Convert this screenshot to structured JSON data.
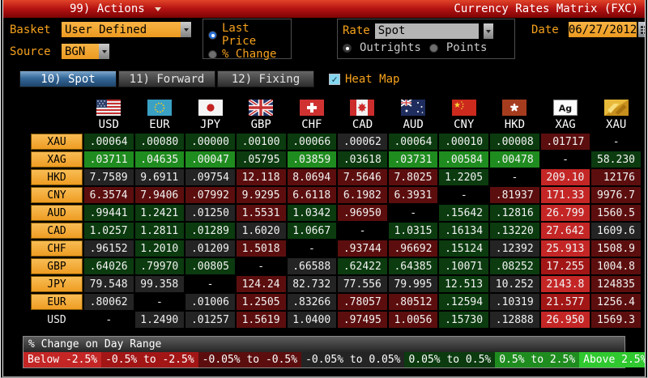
{
  "title_bar": {
    "actions_label": "99) Actions",
    "title": "Currency Rates Matrix (FXC)"
  },
  "controls": {
    "basket_label": "Basket",
    "basket_value": "User Defined",
    "source_label": "Source",
    "source_value": "BGN",
    "price_options": [
      {
        "label": "Last Price",
        "selected": true
      },
      {
        "label": "% Change",
        "selected": false
      }
    ],
    "rate_label": "Rate",
    "rate_value": "Spot",
    "rate_options": [
      {
        "label": "Outrights",
        "selected": true
      },
      {
        "label": "Points",
        "selected": false
      }
    ],
    "date_label": "Date",
    "date_value": "06/27/2012"
  },
  "tabs": [
    {
      "label": "10) Spot",
      "active": true
    },
    {
      "label": "11) Forward",
      "active": false
    },
    {
      "label": "12) Fixing",
      "active": false
    }
  ],
  "heat_map": {
    "label": "Heat Map",
    "checked": true
  },
  "matrix": {
    "columns": [
      "USD",
      "EUR",
      "JPY",
      "GBP",
      "CHF",
      "CAD",
      "AUD",
      "CNY",
      "HKD",
      "XAG",
      "XAU"
    ],
    "flags": [
      "us-flag",
      "eu-flag",
      "jp-flag",
      "uk-flag",
      "ch-flag",
      "ca-flag",
      "au-flag",
      "cn-flag",
      "hk-flag",
      "silver-ag",
      "gold-xau"
    ],
    "rows": [
      {
        "label": "XAU",
        "chip": true,
        "cells": [
          {
            "v": ".00064",
            "c": "g1"
          },
          {
            "v": ".00080",
            "c": "g1"
          },
          {
            "v": ".00000",
            "c": "g1"
          },
          {
            "v": ".00100",
            "c": "g1"
          },
          {
            "v": ".00066",
            "c": "g1"
          },
          {
            "v": ".00062",
            "c": "n"
          },
          {
            "v": ".00064",
            "c": "g1"
          },
          {
            "v": ".00010",
            "c": "g1"
          },
          {
            "v": ".00008",
            "c": "g1"
          },
          {
            "v": ".01717",
            "c": "r1"
          },
          {
            "v": "-",
            "c": "k"
          }
        ]
      },
      {
        "label": "XAG",
        "chip": true,
        "cells": [
          {
            "v": ".03711",
            "c": "g2"
          },
          {
            "v": ".04635",
            "c": "g2"
          },
          {
            "v": ".00047",
            "c": "g2"
          },
          {
            "v": ".05795",
            "c": "g1"
          },
          {
            "v": ".03859",
            "c": "g2"
          },
          {
            "v": ".03618",
            "c": "g1"
          },
          {
            "v": ".03731",
            "c": "g2"
          },
          {
            "v": ".00584",
            "c": "g2"
          },
          {
            "v": ".00478",
            "c": "g2"
          },
          {
            "v": "-",
            "c": "k"
          },
          {
            "v": "58.230",
            "c": "g1"
          }
        ]
      },
      {
        "label": "HKD",
        "chip": true,
        "cells": [
          {
            "v": "7.7589",
            "c": "n"
          },
          {
            "v": "9.6911",
            "c": "n"
          },
          {
            "v": ".09754",
            "c": "n"
          },
          {
            "v": "12.118",
            "c": "r1"
          },
          {
            "v": "8.0694",
            "c": "r1"
          },
          {
            "v": "7.5646",
            "c": "r1"
          },
          {
            "v": "7.8025",
            "c": "r1"
          },
          {
            "v": "1.2205",
            "c": "g1"
          },
          {
            "v": "-",
            "c": "k"
          },
          {
            "v": "209.10",
            "c": "r3"
          },
          {
            "v": "12176",
            "c": "r1"
          }
        ]
      },
      {
        "label": "CNY",
        "chip": true,
        "cells": [
          {
            "v": "6.3574",
            "c": "r1"
          },
          {
            "v": "7.9406",
            "c": "r1"
          },
          {
            "v": ".07992",
            "c": "r1"
          },
          {
            "v": "9.9295",
            "c": "r1"
          },
          {
            "v": "6.6118",
            "c": "r1"
          },
          {
            "v": "6.1982",
            "c": "r1"
          },
          {
            "v": "6.3931",
            "c": "r1"
          },
          {
            "v": "-",
            "c": "k"
          },
          {
            "v": ".81937",
            "c": "r1"
          },
          {
            "v": "171.33",
            "c": "r3"
          },
          {
            "v": "9976.7",
            "c": "r1"
          }
        ]
      },
      {
        "label": "AUD",
        "chip": true,
        "cells": [
          {
            "v": ".99441",
            "c": "g1"
          },
          {
            "v": "1.2421",
            "c": "g1"
          },
          {
            "v": ".01250",
            "c": "n"
          },
          {
            "v": "1.5531",
            "c": "r1"
          },
          {
            "v": "1.0342",
            "c": "g1"
          },
          {
            "v": ".96950",
            "c": "r1"
          },
          {
            "v": "-",
            "c": "k"
          },
          {
            "v": ".15642",
            "c": "g1"
          },
          {
            "v": ".12816",
            "c": "g1"
          },
          {
            "v": "26.799",
            "c": "r3"
          },
          {
            "v": "1560.5",
            "c": "r1"
          }
        ]
      },
      {
        "label": "CAD",
        "chip": true,
        "cells": [
          {
            "v": "1.0257",
            "c": "g1"
          },
          {
            "v": "1.2811",
            "c": "g1"
          },
          {
            "v": ".01289",
            "c": "g1"
          },
          {
            "v": "1.6020",
            "c": "n"
          },
          {
            "v": "1.0667",
            "c": "g1"
          },
          {
            "v": "-",
            "c": "k"
          },
          {
            "v": "1.0315",
            "c": "g1"
          },
          {
            "v": ".16134",
            "c": "g1"
          },
          {
            "v": ".13220",
            "c": "g1"
          },
          {
            "v": "27.642",
            "c": "r3"
          },
          {
            "v": "1609.6",
            "c": "n"
          }
        ]
      },
      {
        "label": "CHF",
        "chip": true,
        "cells": [
          {
            "v": ".96152",
            "c": "n"
          },
          {
            "v": "1.2010",
            "c": "g1"
          },
          {
            "v": ".01209",
            "c": "n"
          },
          {
            "v": "1.5018",
            "c": "r1"
          },
          {
            "v": "-",
            "c": "k"
          },
          {
            "v": ".93744",
            "c": "r1"
          },
          {
            "v": ".96692",
            "c": "r1"
          },
          {
            "v": ".15124",
            "c": "g1"
          },
          {
            "v": ".12392",
            "c": "n"
          },
          {
            "v": "25.913",
            "c": "r3"
          },
          {
            "v": "1508.9",
            "c": "r1"
          }
        ]
      },
      {
        "label": "GBP",
        "chip": true,
        "cells": [
          {
            "v": ".64026",
            "c": "g1"
          },
          {
            "v": ".79970",
            "c": "g1"
          },
          {
            "v": ".00805",
            "c": "g1"
          },
          {
            "v": "-",
            "c": "k"
          },
          {
            "v": ".66588",
            "c": "n"
          },
          {
            "v": ".62422",
            "c": "g1"
          },
          {
            "v": ".64385",
            "c": "g1"
          },
          {
            "v": ".10071",
            "c": "g1"
          },
          {
            "v": ".08252",
            "c": "g1"
          },
          {
            "v": "17.255",
            "c": "r2"
          },
          {
            "v": "1004.8",
            "c": "r1"
          }
        ]
      },
      {
        "label": "JPY",
        "chip": true,
        "cells": [
          {
            "v": "79.548",
            "c": "n"
          },
          {
            "v": "99.358",
            "c": "n"
          },
          {
            "v": "-",
            "c": "k"
          },
          {
            "v": "124.24",
            "c": "r1"
          },
          {
            "v": "82.732",
            "c": "n"
          },
          {
            "v": "77.556",
            "c": "n"
          },
          {
            "v": "79.995",
            "c": "n"
          },
          {
            "v": "12.513",
            "c": "g1"
          },
          {
            "v": "10.252",
            "c": "n"
          },
          {
            "v": "2143.8",
            "c": "r3"
          },
          {
            "v": "124835",
            "c": "r1"
          }
        ]
      },
      {
        "label": "EUR",
        "chip": true,
        "cells": [
          {
            "v": ".80062",
            "c": "n"
          },
          {
            "v": "-",
            "c": "k"
          },
          {
            "v": ".01006",
            "c": "n"
          },
          {
            "v": "1.2505",
            "c": "r1"
          },
          {
            "v": ".83266",
            "c": "n"
          },
          {
            "v": ".78057",
            "c": "r1"
          },
          {
            "v": ".80512",
            "c": "r1"
          },
          {
            "v": ".12594",
            "c": "g1"
          },
          {
            "v": ".10319",
            "c": "n"
          },
          {
            "v": "21.577",
            "c": "r2"
          },
          {
            "v": "1256.4",
            "c": "r1"
          }
        ]
      },
      {
        "label": "USD",
        "chip": false,
        "cells": [
          {
            "v": "-",
            "c": "k"
          },
          {
            "v": "1.2490",
            "c": "n"
          },
          {
            "v": ".01257",
            "c": "n"
          },
          {
            "v": "1.5619",
            "c": "r1"
          },
          {
            "v": "1.0400",
            "c": "n"
          },
          {
            "v": ".97495",
            "c": "r1"
          },
          {
            "v": "1.0056",
            "c": "r1"
          },
          {
            "v": ".15730",
            "c": "g1"
          },
          {
            "v": ".12888",
            "c": "n"
          },
          {
            "v": "26.950",
            "c": "r3"
          },
          {
            "v": "1569.3",
            "c": "r1"
          }
        ]
      }
    ]
  },
  "legend": {
    "title": "% Change on Day Range",
    "ranges": [
      {
        "label": "Below -2.5%",
        "c": "r3"
      },
      {
        "label": "-0.5% to -2.5%",
        "c": "r2"
      },
      {
        "label": "-0.05% to -0.5%",
        "c": "r1"
      },
      {
        "label": "-0.05% to 0.05%",
        "c": "n"
      },
      {
        "label": "0.05% to 0.5%",
        "c": "g1"
      },
      {
        "label": "0.5% to 2.5%",
        "c": "g2"
      },
      {
        "label": "Above 2.5%",
        "c": "g3"
      }
    ]
  },
  "colors": {
    "g1": "#0b3b0f",
    "g2": "#1f8c1f",
    "g3": "#2fc82f",
    "n": "#242424",
    "k": "#000000",
    "r1": "#5c0e0e",
    "r2": "#a31616",
    "r3": "#c42626",
    "accent_amber": "#f6a21d",
    "titlebar_red": "#b41212",
    "tab_active_blue": "#35689a"
  }
}
